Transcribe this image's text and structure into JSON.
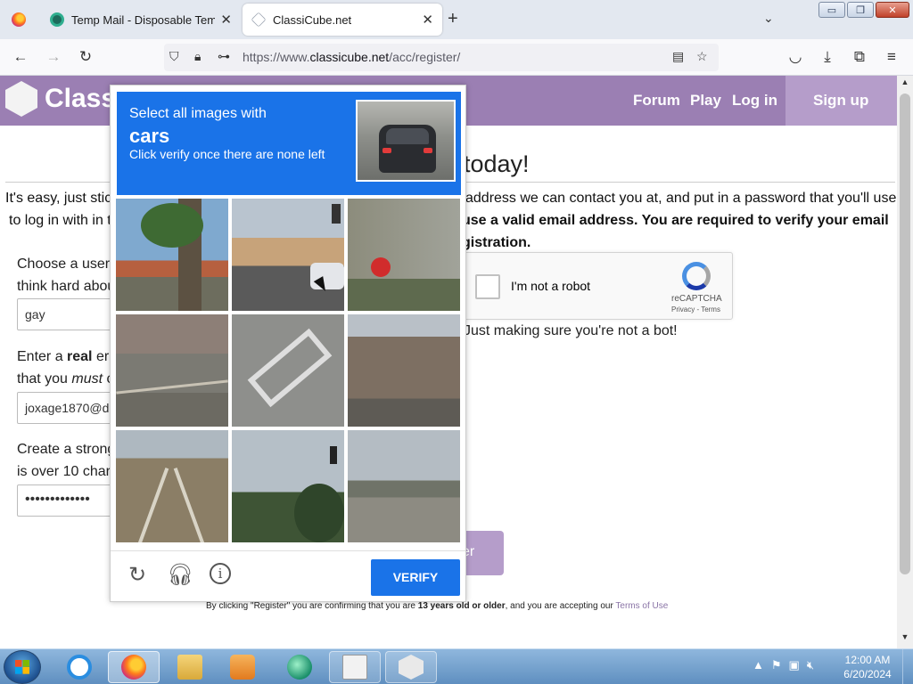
{
  "browser": {
    "tabs": [
      {
        "title": "Temp Mail - Disposable Tempo",
        "close": "✕"
      },
      {
        "title": "ClassiCube.net",
        "close": "✕"
      }
    ],
    "new_tab": "+",
    "tab_list": "⌄",
    "window_buttons": {
      "minimize": "▭",
      "restore": "❐",
      "close": "✕"
    },
    "url_prefix": "https://www.",
    "url_domain": "classicube.net",
    "url_path": "/acc/register/"
  },
  "site": {
    "brand": "Class",
    "nav": {
      "forum": "Forum",
      "play": "Play",
      "login": "Log in",
      "signup": "Sign up"
    },
    "heading_visible": "today!",
    "intro": {
      "line1_left": "It's easy, just stic",
      "line1_right": "address we can contact you at, and put in a password that you'll use",
      "line2_left": "to log in with in t",
      "line2_right": "use a valid email address. You are required to verify your email",
      "line3_right": "gistration."
    },
    "form": {
      "username_label_1": "Choose a user",
      "username_label_2": "think hard abou",
      "username_value": "gay",
      "email_label_1_pre": "Enter a ",
      "email_label_1_bold": "real",
      "email_label_1_post": " er",
      "email_label_2_pre": "that you ",
      "email_label_2_em": "must",
      "email_label_2_post": " c",
      "email_value": "joxage1870@d",
      "password_label_1": "Create a strong",
      "password_label_2": "is over 10 char",
      "password_value": "•••••••••••••"
    },
    "recaptcha": {
      "label": "I'm not a robot",
      "brand": "reCAPTCHA",
      "terms": "Privacy - Terms"
    },
    "bot_note": "Just making sure you're not a bot!",
    "register_visible": "er",
    "legal": {
      "pre": "By clicking \"Register\" you are confirming that you are ",
      "bold": "13 years old or older",
      "mid": ", and you are accepting our ",
      "link": "Terms of Use"
    }
  },
  "captcha": {
    "instruction": "Select all images with",
    "target": "cars",
    "hint": "Click verify once there are none left",
    "verify": "VERIFY",
    "tiles": [
      "palm tree and roof",
      "street with traffic light and car",
      "building with stop sign",
      "railway track",
      "road marking ONLY",
      "brick building corner",
      "tram tracks",
      "traffic light and trees",
      "overpass bridge"
    ]
  },
  "taskbar": {
    "apps": [
      "Internet Explorer",
      "Firefox",
      "Windows Explorer",
      "Media Player",
      "Browser",
      "Application",
      "ClassiCube"
    ],
    "time": "12:00 AM",
    "date": "6/20/2024"
  }
}
